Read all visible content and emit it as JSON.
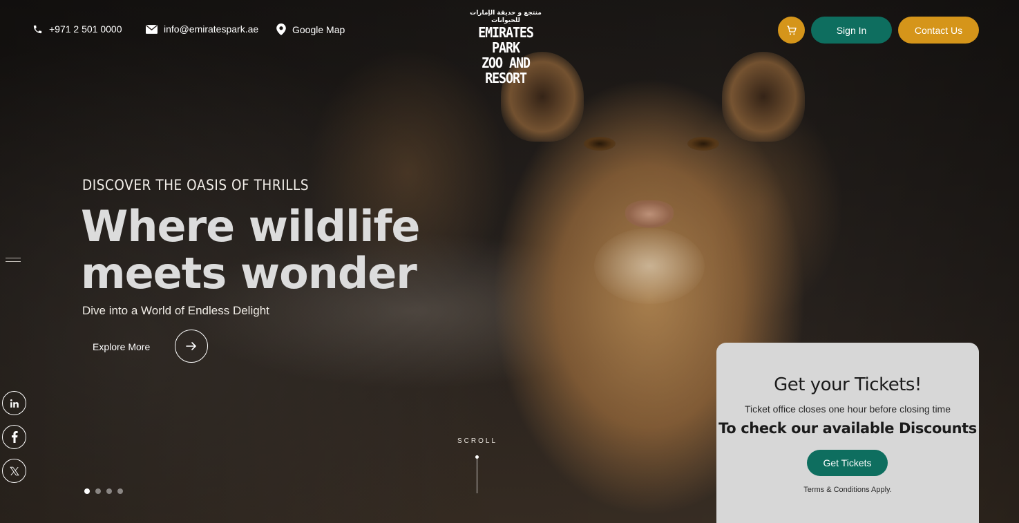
{
  "topbar": {
    "phone": "+971 2 501 0000",
    "email": "info@emiratespark.ae",
    "map": "Google Map"
  },
  "logo": {
    "arabic": "منتجع و حديقة الإمارات للحيوانات",
    "line1": "EMIRATES PARK",
    "line2": "ZOO AND RESORT"
  },
  "header_actions": {
    "cart_icon": "cart-icon",
    "signin_label": "Sign In",
    "contact_label": "Contact Us"
  },
  "hero": {
    "kicker": "DISCOVER THE OASIS OF THRILLS",
    "headline_line1": "Where wildlife",
    "headline_line2": "meets wonder",
    "subline": "Dive into a World of Endless Delight",
    "explore_label": "Explore More",
    "scroll_label": "SCROLL",
    "slides_count": 4,
    "active_slide": 1
  },
  "social": [
    "linkedin-icon",
    "facebook-icon",
    "x-icon"
  ],
  "ticket": {
    "title": "Get your Tickets!",
    "note": "Ticket office closes one hour before closing time",
    "discount": "To check our available Discounts",
    "button": "Get Tickets",
    "terms": "Terms & Conditions Apply."
  },
  "colors": {
    "brand_green": "#0e6e5f",
    "brand_gold": "#d5951a",
    "card_bg": "#d7d7d7"
  }
}
